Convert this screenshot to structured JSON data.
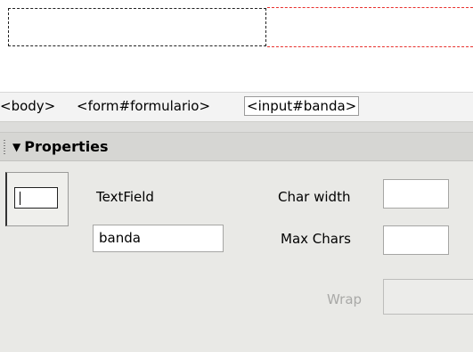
{
  "tag_selector": {
    "body": "<body>",
    "form": "<form#formulario>",
    "input": "<input#banda>"
  },
  "panel": {
    "title": "Properties",
    "collapse_glyph": "▼",
    "element_type": "TextField",
    "name_value": "banda",
    "char_width_label": "Char width",
    "char_width_value": "",
    "max_chars_label": "Max Chars",
    "max_chars_value": "",
    "wrap_label": "Wrap",
    "wrap_value": ""
  },
  "colors": {
    "selection_outline": "#222222",
    "guide_red": "#e8312e",
    "panel_bg": "#e9e9e6"
  }
}
